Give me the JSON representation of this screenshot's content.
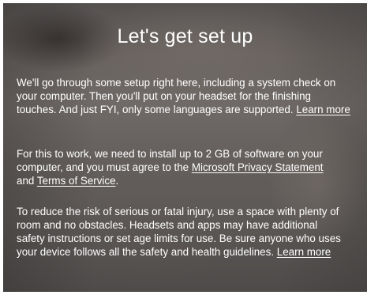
{
  "setup": {
    "title": "Let's get set up",
    "para1": {
      "line1": "We'll go through some setup right here, including a system check on",
      "line2": "your computer. Then you'll put on your headset for the finishing",
      "line3": "touches. And just FYI, only some languages are supported. ",
      "learn_more": "Learn more"
    },
    "para2": {
      "line1": "For this to work, we need to install up to 2 GB of software on your",
      "line2": "computer, and you must agree to the ",
      "privacy_link": "Microsoft Privacy Statement",
      "line3_pre": "and ",
      "terms_link": "Terms of Service",
      "line3_post": "."
    },
    "para3": {
      "line1": "To reduce the risk of serious or fatal injury, use a space with plenty of",
      "line2": "room and no obstacles. Headsets and apps may have additional",
      "line3": "safety instructions or set age limits for use. Be sure anyone who uses",
      "line4": "your device follows all the safety and health guidelines. ",
      "learn_more": "Learn more"
    }
  }
}
